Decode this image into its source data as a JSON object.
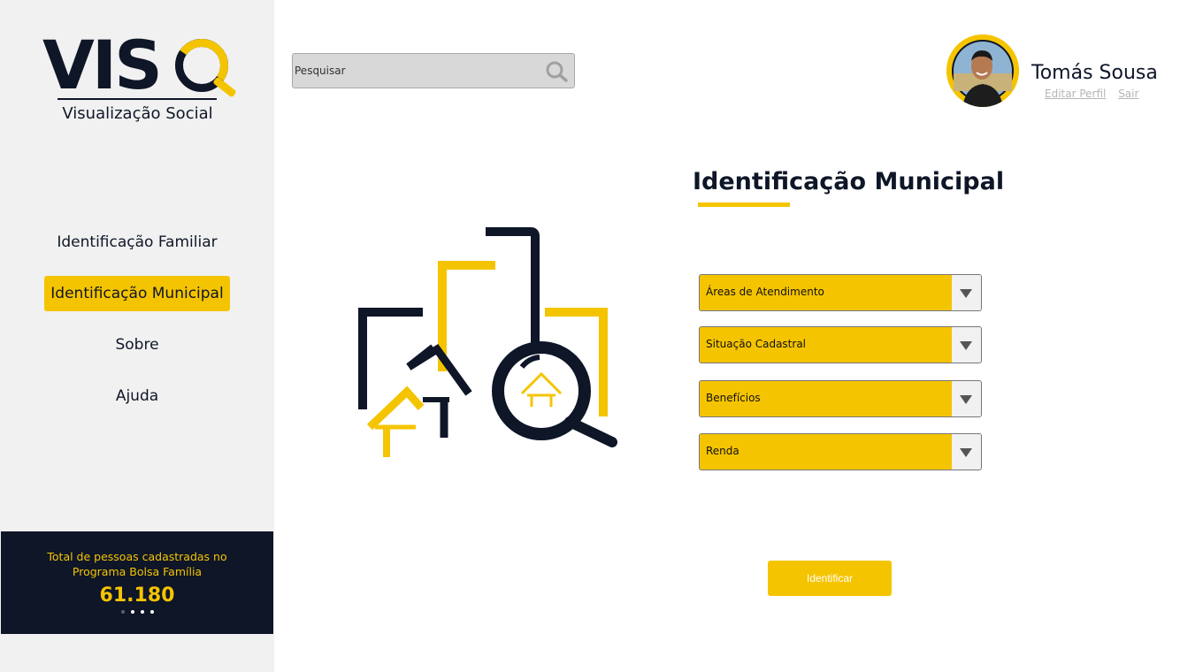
{
  "brand": {
    "logo_text": "VISQ",
    "subtitle": "Visualização Social"
  },
  "nav": {
    "items": [
      {
        "label": "Identificação Familiar",
        "active": false
      },
      {
        "label": "Identificação Municipal",
        "active": true
      },
      {
        "label": "Sobre",
        "active": false
      },
      {
        "label": "Ajuda",
        "active": false
      }
    ]
  },
  "stats": {
    "label": "Total de pessoas cadastradas no Programa Bolsa Família",
    "value": "61.180",
    "carousel_dots": 4,
    "active_dot": 1
  },
  "search": {
    "placeholder": "Pesquisar"
  },
  "profile": {
    "name": "Tomás Sousa",
    "edit_label": "Editar Perfil",
    "logout_label": "Sair"
  },
  "main": {
    "title": "Identificação Municipal",
    "selects": [
      {
        "label": "Áreas de Atendimento"
      },
      {
        "label": "Situação Cadastral"
      },
      {
        "label": "Benefícios"
      },
      {
        "label": "Renda"
      }
    ],
    "submit_label": "Identificar"
  },
  "colors": {
    "accent": "#f5c400",
    "navy": "#0e1628",
    "sidebar_bg": "#f1f1f1"
  }
}
